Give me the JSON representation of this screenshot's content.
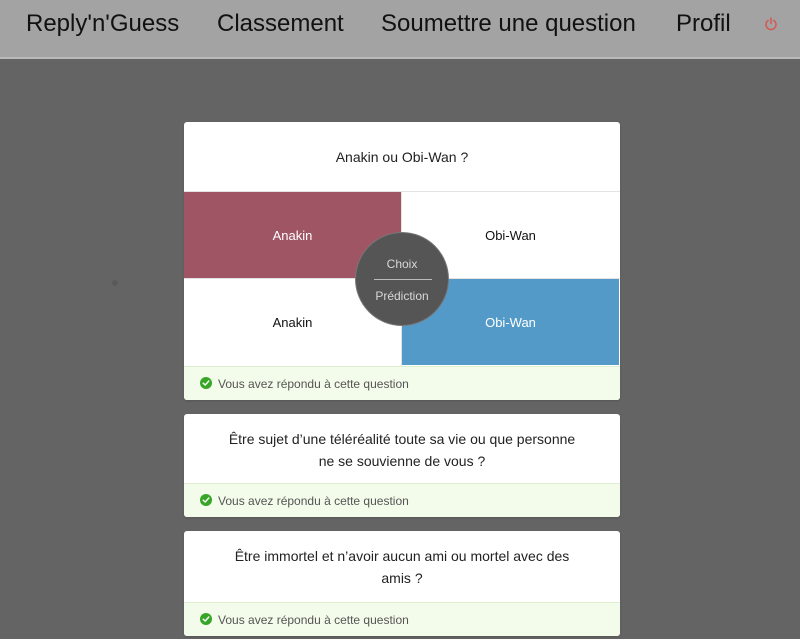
{
  "nav": {
    "brand": "Reply'n'Guess",
    "ranking": "Classement",
    "submit": "Soumettre une question",
    "profile": "Profil",
    "power_icon": "power-icon",
    "power_color": "#d9534f"
  },
  "colors": {
    "choice_selected": "#a05565",
    "prediction_selected": "#549ac8",
    "answered_bg": "#f3fbea",
    "check": "#37a628"
  },
  "questions": [
    {
      "text": "Anakin ou Obi-Wan ?",
      "choice": {
        "left": "Anakin",
        "right": "Obi-Wan"
      },
      "prediction": {
        "left": "Anakin",
        "right": "Obi-Wan"
      },
      "center_top": "Choix",
      "center_bottom": "Prédiction",
      "status": "Vous avez répondu à cette question"
    },
    {
      "text_line1": "Être sujet d’une téléréalité toute sa vie ou que personne",
      "text_line2": "ne se souvienne de vous ?",
      "status": "Vous avez répondu à cette question"
    },
    {
      "text_line1": "Être immortel et n’avoir aucun ami ou mortel avec des",
      "text_line2": "amis ?",
      "status": "Vous avez répondu à cette question"
    }
  ]
}
